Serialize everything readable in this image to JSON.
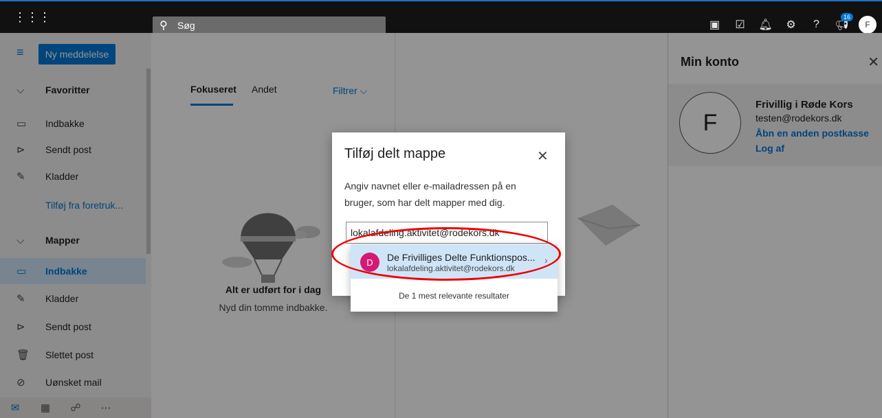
{
  "topbar": {
    "search_placeholder": "Søg",
    "notification_badge": "16",
    "avatar_initial": "F"
  },
  "leftnav": {
    "new_message_label": "Ny meddelelse",
    "favorites_header": "Favoritter",
    "favorites": [
      {
        "label": "Indbakke",
        "icon": "inbox-icon"
      },
      {
        "label": "Sendt post",
        "icon": "send-icon"
      },
      {
        "label": "Kladder",
        "icon": "pencil-icon"
      },
      {
        "label": "Tilføj fra foretruk...",
        "icon": ""
      }
    ],
    "folders_header": "Mapper",
    "folders": [
      {
        "label": "Indbakke",
        "icon": "inbox-icon",
        "selected": true
      },
      {
        "label": "Kladder",
        "icon": "pencil-icon"
      },
      {
        "label": "Sendt post",
        "icon": "send-icon"
      },
      {
        "label": "Slettet post",
        "icon": "trash-icon"
      },
      {
        "label": "Uønsket mail",
        "icon": "block-icon"
      }
    ],
    "bottom_icons": [
      "mail-icon",
      "calendar-icon",
      "people-icon",
      "more-icon"
    ]
  },
  "msglist": {
    "tab_focused": "Fokuseret",
    "tab_other": "Andet",
    "filter_label": "Filtrer",
    "empty_title": "Alt er udført for i dag",
    "empty_subtitle": "Nyd din tomme indbakke."
  },
  "account": {
    "header": "Min konto",
    "initial": "F",
    "name": "Frivillig i Røde Kors",
    "email": "testen@rodekors.dk",
    "open_other_mailbox": "Åbn en anden postkasse",
    "sign_out": "Log af"
  },
  "dialog": {
    "title": "Tilføj delt mappe",
    "description": "Angiv navnet eller e-mailadressen på en bruger, som har delt mapper med dig.",
    "input_value": "lokalafdeling.aktivitet@rodekors.dk"
  },
  "suggestion": {
    "initial": "D",
    "name": "De Frivilliges Delte Funktionspos...",
    "email": "lokalafdeling.aktivitet@rodekors.dk",
    "footer": "De 1 mest relevante resultater"
  },
  "colors": {
    "accent": "#0078d4",
    "suggestion_avatar": "#d41a74",
    "annotation": "#ee0000"
  }
}
